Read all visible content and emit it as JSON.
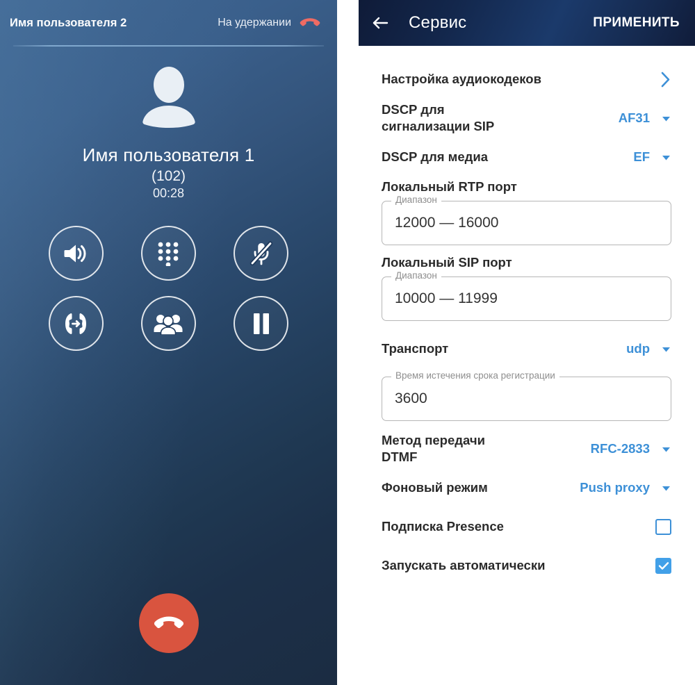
{
  "call": {
    "held_party_name": "Имя пользователя 2",
    "held_status": "На удержании",
    "held_hangup_icon": "hangup-icon",
    "avatar_icon": "avatar-person-icon",
    "active_party_name": "Имя пользователя 1",
    "active_party_extension": "(102)",
    "duration": "00:28",
    "end_call_icon": "hangup-icon",
    "accent_red": "#d9543f",
    "held_icon_color": "#ef6b63",
    "controls": [
      {
        "name": "speaker-button",
        "icon": "speaker-icon"
      },
      {
        "name": "dialpad-button",
        "icon": "dialpad-icon"
      },
      {
        "name": "mute-button",
        "icon": "microphone-off-icon"
      },
      {
        "name": "transfer-button",
        "icon": "call-transfer-icon"
      },
      {
        "name": "conference-button",
        "icon": "people-group-icon"
      },
      {
        "name": "hold-button",
        "icon": "pause-icon"
      }
    ]
  },
  "settings": {
    "back_icon": "arrow-left-icon",
    "title": "Сервис",
    "apply_label": "ПРИМЕНИТЬ",
    "accent_blue": "#3d90d7",
    "rows": {
      "audio_codecs": {
        "label": "Настройка аудиокодеков",
        "chevron_icon": "chevron-right-icon"
      },
      "dscp_sip": {
        "label": "DSCP для\nсигнализации SIP",
        "value": "AF31",
        "caret_icon": "caret-down-icon"
      },
      "dscp_media": {
        "label": "DSCP для медиа",
        "value": "EF",
        "caret_icon": "caret-down-icon"
      },
      "rtp_port": {
        "title": "Локальный RTP порт",
        "legend": "Диапазон",
        "value": "12000 — 16000"
      },
      "sip_port": {
        "title": "Локальный SIP порт",
        "legend": "Диапазон",
        "value": "10000 — 11999"
      },
      "transport": {
        "label": "Транспорт",
        "value": "udp",
        "caret_icon": "caret-down-icon"
      },
      "reg_expiry": {
        "legend": "Время истечения срока регистрации",
        "value": "3600"
      },
      "dtmf": {
        "label": "Метод передачи\nDTMF",
        "value": "RFC-2833",
        "caret_icon": "caret-down-icon"
      },
      "background_mode": {
        "label": "Фоновый режим",
        "value": "Push proxy",
        "caret_icon": "caret-down-icon"
      },
      "presence": {
        "label": "Подписка Presence",
        "checked": false
      },
      "autostart": {
        "label": "Запускать автоматически",
        "checked": true
      }
    }
  }
}
